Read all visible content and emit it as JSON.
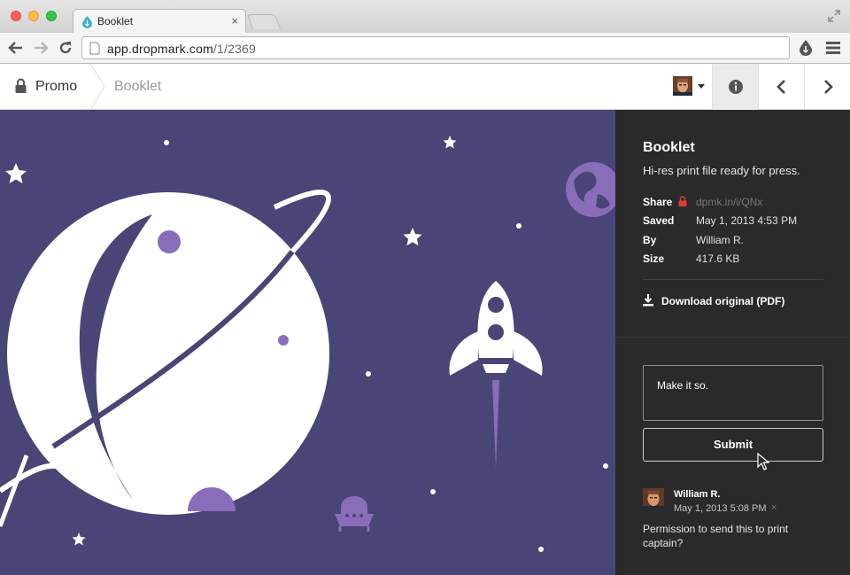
{
  "browser": {
    "tab_title": "Booklet",
    "tab_close": "×",
    "url_domain": "app.dropmark.com",
    "url_path": "/1/2369"
  },
  "header": {
    "collection": "Promo",
    "item": "Booklet"
  },
  "item": {
    "title": "Booklet",
    "description": "Hi-res print file ready for press.",
    "share_label": "Share",
    "share_link": "dpmk.in/i/QNx",
    "saved_label": "Saved",
    "saved_value": "May 1, 2013 4:53 PM",
    "by_label": "By",
    "by_value": "William R.",
    "size_label": "Size",
    "size_value": "417.6 KB",
    "download_label": "Download original (PDF)"
  },
  "comment_form": {
    "value": "Make it so.",
    "submit_label": "Submit"
  },
  "comments": [
    {
      "author": "William R.",
      "time": "May 1, 2013 5:08 PM",
      "delete": "×",
      "text": "Permission to send this to print captain?"
    }
  ],
  "colors": {
    "artwork_bg": "#4a4577",
    "artwork_accent": "#8a6db8",
    "sidebar_bg": "#2a2a2a"
  }
}
